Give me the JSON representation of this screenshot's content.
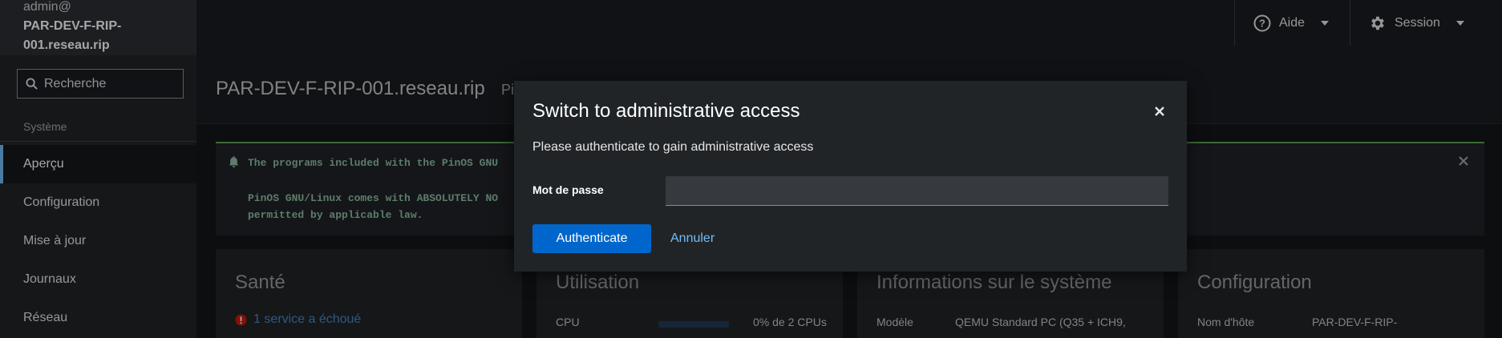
{
  "sidebar": {
    "user": "admin@",
    "host_line1": "PAR-DEV-F-RIP-",
    "host_line2": "001.reseau.rip",
    "search_placeholder": "Recherche",
    "section_label": "Système",
    "items": [
      {
        "label": "Aperçu",
        "active": true
      },
      {
        "label": "Configuration",
        "active": false
      },
      {
        "label": "Mise à jour",
        "active": false
      },
      {
        "label": "Journaux",
        "active": false
      },
      {
        "label": "Réseau",
        "active": false
      }
    ]
  },
  "topbar": {
    "help_label": "Aide",
    "session_label": "Session"
  },
  "header": {
    "title": "PAR-DEV-F-RIP-001.reseau.rip",
    "subtitle": "Pi"
  },
  "alert": {
    "line1": "The programs included with the PinOS GNU",
    "line2": "PinOS GNU/Linux comes with ABSOLUTELY NO",
    "line3": "permitted by applicable law."
  },
  "cards": {
    "health_title": "Santé",
    "health_status": "1 service a échoué",
    "usage_title": "Utilisation",
    "cpu_label": "CPU",
    "cpu_value": "0% de 2 CPUs",
    "cpu_usage": 0,
    "sysinfo_title": "Informations sur le système",
    "model_label": "Modèle",
    "model_value": "QEMU Standard PC (Q35 + ICH9,",
    "config_title": "Configuration",
    "hostname_label": "Nom d'hôte",
    "hostname_value": "PAR-DEV-F-RIP-"
  },
  "modal": {
    "title": "Switch to administrative access",
    "description": "Please authenticate to gain administrative access",
    "password_label": "Mot de passe",
    "password_value": "",
    "authenticate_label": "Authenticate",
    "cancel_label": "Annuler"
  },
  "colors": {
    "accent": "#0066cc",
    "link": "#73bcf7",
    "alert_border": "#5ba352",
    "danger": "#c9190b"
  }
}
